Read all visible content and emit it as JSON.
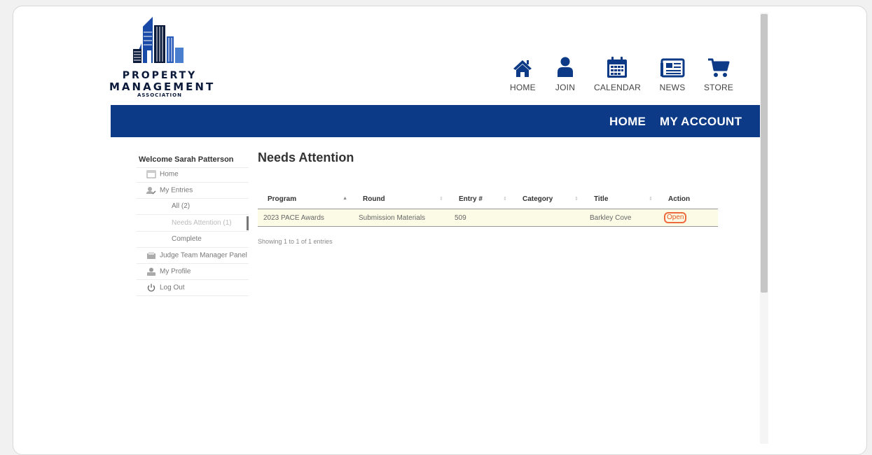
{
  "brand": {
    "line1": "PROPERTY",
    "line2": "MANAGEMENT",
    "line3": "ASSOCIATION",
    "colors": {
      "navy": "#0b1a3a",
      "blue": "#1a4aa8",
      "light": "#4a7fd0"
    }
  },
  "top_nav": [
    {
      "label": "HOME",
      "icon": "home-icon"
    },
    {
      "label": "JOIN",
      "icon": "user-icon"
    },
    {
      "label": "CALENDAR",
      "icon": "calendar-icon"
    },
    {
      "label": "NEWS",
      "icon": "newspaper-icon"
    },
    {
      "label": "STORE",
      "icon": "cart-icon"
    }
  ],
  "main_nav": {
    "home": "HOME",
    "account": "MY ACCOUNT",
    "bar_color": "#0d3a86"
  },
  "sidebar": {
    "welcome": "Welcome Sarah Patterson",
    "home": "Home",
    "my_entries": "My Entries",
    "all": "All (2)",
    "needs_attention": "Needs Attention (1)",
    "complete": "Complete",
    "judge_panel": "Judge Team Manager Panel",
    "my_profile": "My Profile",
    "log_out": "Log Out"
  },
  "main": {
    "title": "Needs Attention",
    "columns": [
      "Program",
      "Round",
      "Entry #",
      "Category",
      "Title",
      "Action"
    ],
    "rows": [
      {
        "program": "2023 PACE Awards",
        "round": "Submission Materials",
        "entry": "509",
        "category": "",
        "title": "Barkley Cove",
        "action": "Open"
      }
    ],
    "info": "Showing 1 to 1 of 1 entries"
  },
  "accent_colors": {
    "highlight": "#ee6a3c",
    "row_bg": "#fbfbe6"
  }
}
